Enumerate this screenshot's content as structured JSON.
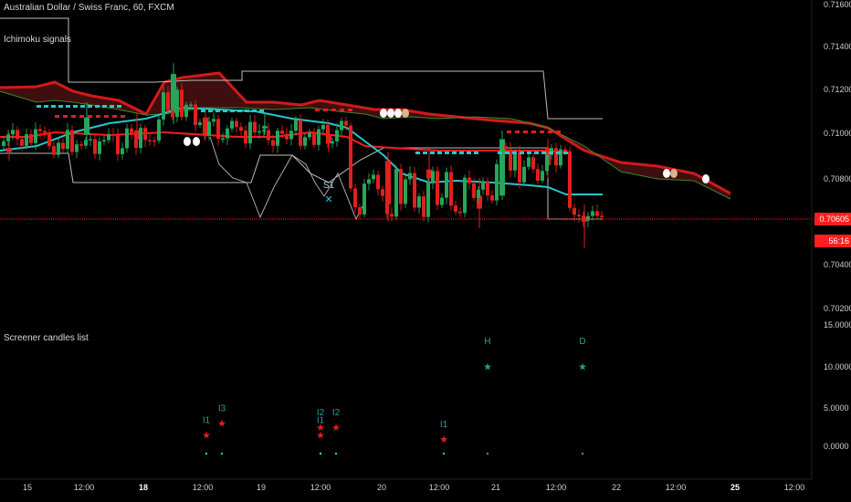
{
  "header": {
    "title": "Australian Dollar / Swiss Franc, 60, FXCM",
    "pane1_name": "Ichimoku signals",
    "pane2_name": "Screener candles list"
  },
  "price_axis": {
    "ticks": [
      "0.71600",
      "0.71400",
      "0.71200",
      "0.71000",
      "0.70800",
      "0.70600",
      "0.70400",
      "0.70200"
    ],
    "current_price": "0.70605",
    "countdown": "56:16"
  },
  "screener_axis": {
    "ticks": [
      "15.0000",
      "10.0000",
      "5.0000",
      "0.0000"
    ]
  },
  "time_axis": {
    "ticks": [
      "15",
      "12:00",
      "18",
      "12:00",
      "19",
      "12:00",
      "20",
      "12:00",
      "21",
      "12:00",
      "22",
      "12:00",
      "25",
      "12:00"
    ],
    "bold": [
      false,
      false,
      true,
      false,
      false,
      false,
      false,
      false,
      false,
      false,
      false,
      false,
      true,
      false
    ]
  },
  "colors": {
    "bull": "#26a65b",
    "bear": "#e0201d",
    "tenkan": "#29c7c7",
    "kijun": "#ff1a1a",
    "chikou": "#aaaaaa",
    "span_a": "#d11a1a",
    "span_b": "#3a8a2a",
    "cloud_bear": "#5a1414",
    "cloud_bull": "#2a3a14",
    "price_line": "#ff1e1e"
  },
  "chart_data": [
    {
      "type": "candlestick",
      "title": "Australian Dollar / Swiss Franc, 60, FXCM",
      "ylim": [
        0.701,
        0.716
      ],
      "approx_ohlc": [
        {
          "x": "15 00:00",
          "o": 0.7094,
          "h": 0.7101,
          "l": 0.7088,
          "c": 0.7092
        },
        {
          "x": "15 12:00",
          "o": 0.71,
          "h": 0.7115,
          "l": 0.7095,
          "c": 0.7108
        },
        {
          "x": "18 00:00",
          "o": 0.7102,
          "h": 0.711,
          "l": 0.7094,
          "c": 0.7098
        },
        {
          "x": "18 06:00",
          "o": 0.711,
          "h": 0.7133,
          "l": 0.7105,
          "c": 0.7128
        },
        {
          "x": "18 12:00",
          "o": 0.7108,
          "h": 0.7112,
          "l": 0.7098,
          "c": 0.71
        },
        {
          "x": "19 00:00",
          "o": 0.7103,
          "h": 0.711,
          "l": 0.71,
          "c": 0.7104
        },
        {
          "x": "19 12:00",
          "o": 0.71,
          "h": 0.7104,
          "l": 0.7092,
          "c": 0.7096
        },
        {
          "x": "20 00:00",
          "o": 0.7088,
          "h": 0.7092,
          "l": 0.706,
          "c": 0.7068
        },
        {
          "x": "20 12:00",
          "o": 0.7084,
          "h": 0.7094,
          "l": 0.7078,
          "c": 0.708
        },
        {
          "x": "21 00:00",
          "o": 0.7072,
          "h": 0.708,
          "l": 0.7057,
          "c": 0.7066
        },
        {
          "x": "21 06:00",
          "o": 0.7072,
          "h": 0.7102,
          "l": 0.707,
          "c": 0.7098
        },
        {
          "x": "21 12:00",
          "o": 0.7094,
          "h": 0.7098,
          "l": 0.708,
          "c": 0.7086
        },
        {
          "x": "21 20:00",
          "o": 0.7062,
          "h": 0.7068,
          "l": 0.7048,
          "c": 0.706
        }
      ],
      "current_price": 0.70605,
      "signals": [
        {
          "label": "S1",
          "x": "19 18:00",
          "y": 0.7072,
          "marker": "x"
        }
      ]
    },
    {
      "type": "scatter",
      "title": "Screener candles list",
      "ylim": [
        0,
        15
      ],
      "series": [
        {
          "name": "",
          "points": [
            {
              "x": "18 12:00",
              "y": 1.5,
              "label": "I1"
            },
            {
              "x": "18 14:00",
              "y": 3.0,
              "label": "I3"
            },
            {
              "x": "19 12:00",
              "y": 2.5,
              "label": "I2"
            },
            {
              "x": "19 12:00",
              "y": 1.5,
              "label": "I1"
            },
            {
              "x": "19 14:00",
              "y": 2.5,
              "label": "I2"
            },
            {
              "x": "20 12:00",
              "y": 1.0,
              "label": "I1"
            },
            {
              "x": "21 00:00",
              "y": 10.0,
              "label": "H"
            },
            {
              "x": "21 20:00",
              "y": 10.0,
              "label": "D"
            }
          ]
        }
      ]
    }
  ]
}
